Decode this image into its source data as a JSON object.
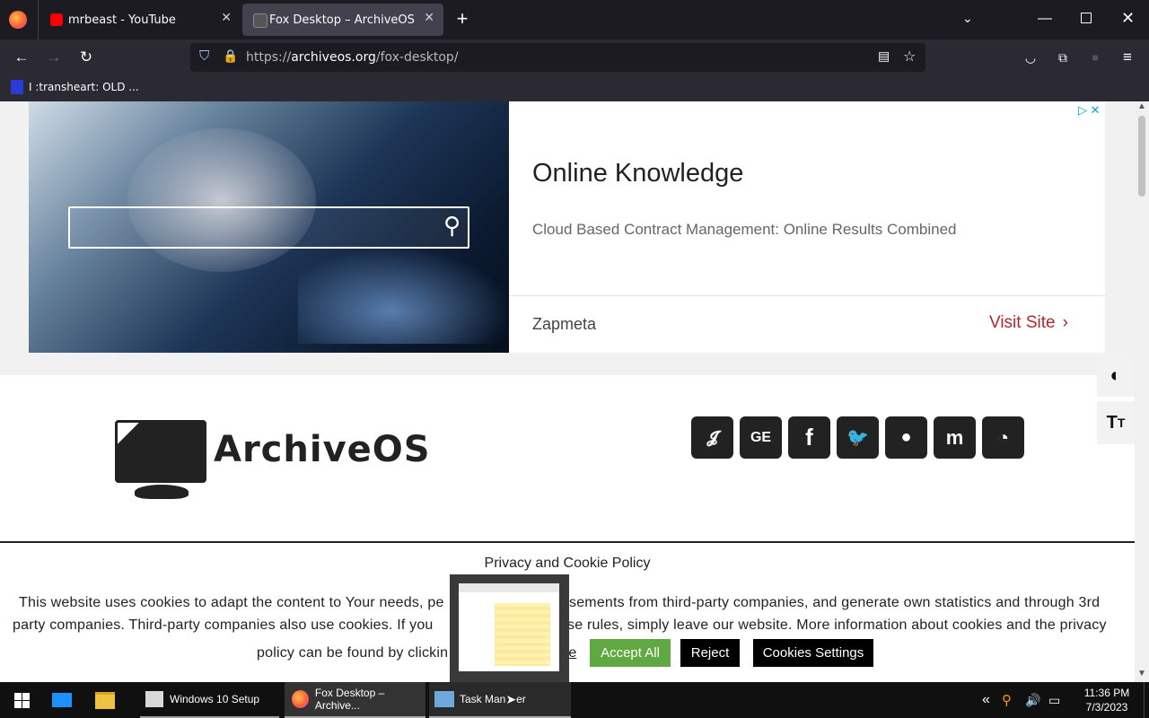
{
  "browser": {
    "tabs": [
      {
        "label": "mrbeast - YouTube",
        "active": false
      },
      {
        "label": "Fox Desktop – ArchiveOS",
        "active": true
      }
    ],
    "url_prefix": "https://",
    "url_domain": "archiveos.org",
    "url_path": "/fox-desktop/",
    "bookmarks": [
      {
        "label": "I :transheart: OLD ..."
      }
    ]
  },
  "ad": {
    "headline": "Online Knowledge",
    "description": "Cloud Based Contract Management: Online Results Combined",
    "advertiser": "Zapmeta",
    "cta": "Visit Site"
  },
  "site": {
    "logo_text": "ArchiveOS",
    "social_icons": [
      "kofi-icon",
      "ge-icon",
      "facebook-icon",
      "twitter-icon",
      "reddit-icon",
      "mastodon-icon",
      "rss-icon"
    ]
  },
  "cookie": {
    "title": "Privacy and Cookie Policy",
    "line1_a": "This website uses cookies to adapt the content to Your needs, pe",
    "line1_b": "sements from third-party companies, and generate own statistics and through 3rd",
    "line2_a": "party companies. Third-party companies also use cookies. If you",
    "line2_b": "se rules, simply leave our website. More information about cookies and the privacy",
    "line3_a": "policy can be found by clickin",
    "line3_link": "re",
    "accept": "Accept All",
    "reject": "Reject",
    "settings": "Cookies Settings"
  },
  "taskbar": {
    "items": [
      {
        "label": "Windows 10 Setup"
      },
      {
        "label": "Fox Desktop – Archive..."
      },
      {
        "label": "Task Man",
        "label_tail": "er"
      }
    ],
    "time": "11:36 PM",
    "date": "7/3/2023"
  },
  "colors": {
    "accept": "#5fa842",
    "cta": "#b3262d",
    "browser_dark": "#1c1b22"
  }
}
